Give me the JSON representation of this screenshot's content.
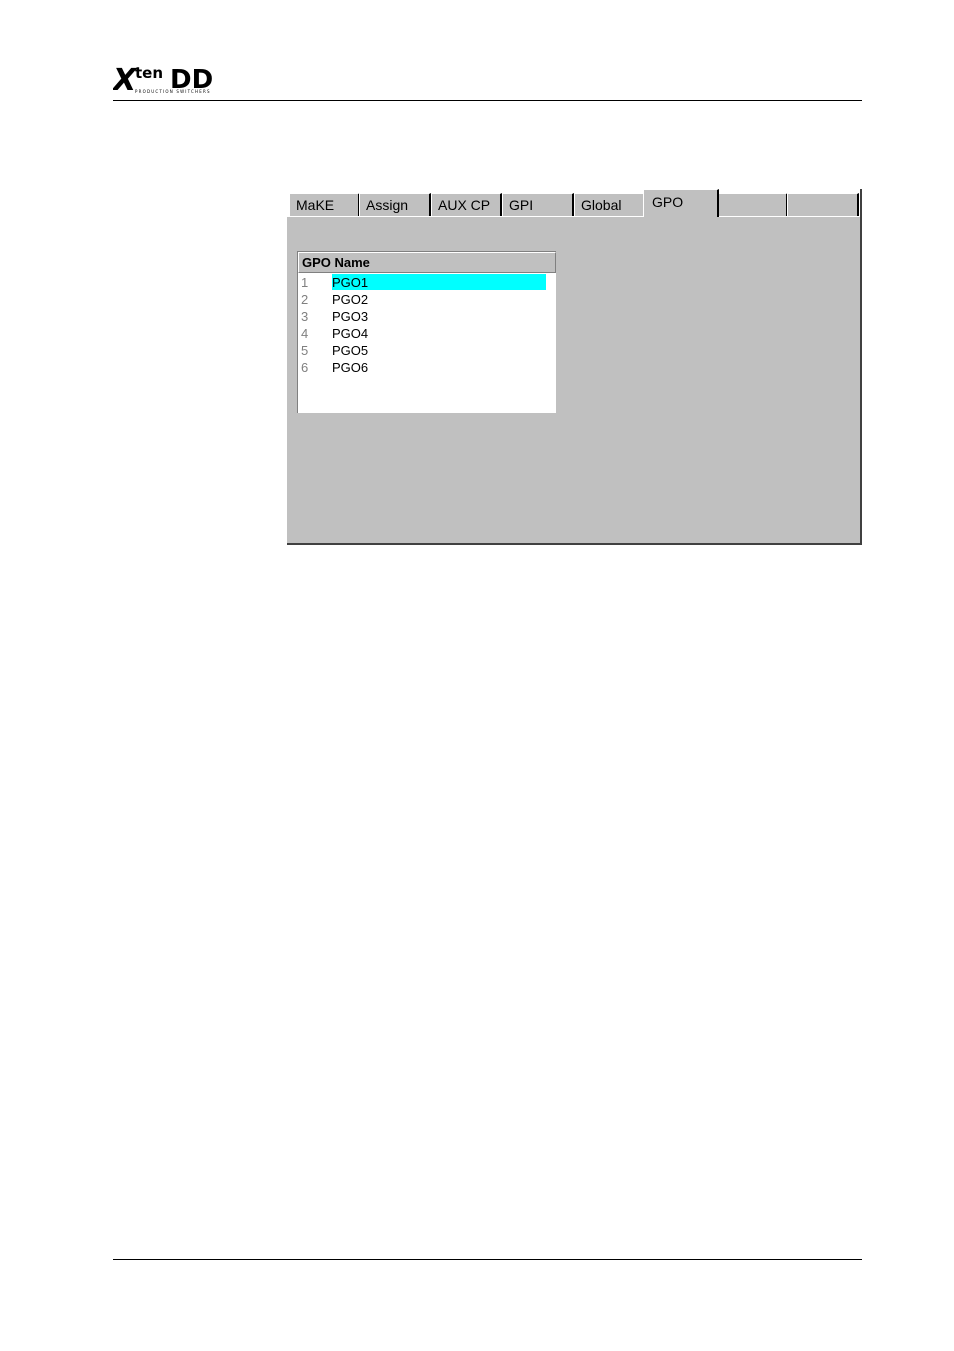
{
  "header": {
    "logo_text": "Xten DD",
    "logo_subtext": "PRODUCTION SWITCHERS"
  },
  "tabs": [
    {
      "label": "MaKE"
    },
    {
      "label": "Assign"
    },
    {
      "label": "AUX CP"
    },
    {
      "label": "GPI"
    },
    {
      "label": "Global"
    },
    {
      "label": "GPO",
      "active": true
    },
    {
      "label": ""
    },
    {
      "label": ""
    }
  ],
  "gpo_list": {
    "header": "GPO Name",
    "rows": [
      {
        "num": "1",
        "name": "PGO1",
        "selected": true
      },
      {
        "num": "2",
        "name": "PGO2"
      },
      {
        "num": "3",
        "name": "PGO3"
      },
      {
        "num": "4",
        "name": "PGO4"
      },
      {
        "num": "5",
        "name": "PGO5"
      },
      {
        "num": "6",
        "name": "PGO6"
      }
    ]
  },
  "colors": {
    "panel": "#c0c0c0",
    "selection": "#00ffff"
  }
}
